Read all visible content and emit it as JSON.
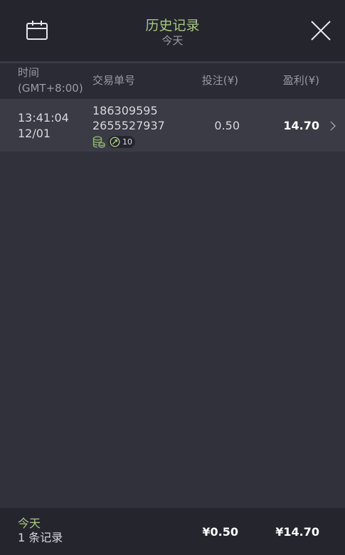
{
  "header": {
    "title": "历史记录",
    "subtitle": "今天",
    "calendar_icon": "calendar-icon",
    "close_icon": "close-icon"
  },
  "columns": {
    "time_line1": "时间",
    "time_line2": "(GMT+8:00)",
    "order": "交易单号",
    "bet": "投注(¥)",
    "profit": "盈利(¥)"
  },
  "rows": [
    {
      "time": "13:41:04",
      "date": "12/01",
      "order_line1": "186309595",
      "order_line2": "2655527937",
      "icons": [
        "coins-icon",
        "free-spin-icon"
      ],
      "badge_count": "10",
      "bet": "0.50",
      "profit": "14.70"
    }
  ],
  "footer": {
    "period": "今天",
    "count": "1 条记录",
    "total_bet": "¥0.50",
    "total_profit": "¥14.70"
  },
  "colors": {
    "accent_green": "#a7c97f",
    "background": "#31313b",
    "header_bg": "#25252e",
    "row_bg": "#3b3b46"
  }
}
